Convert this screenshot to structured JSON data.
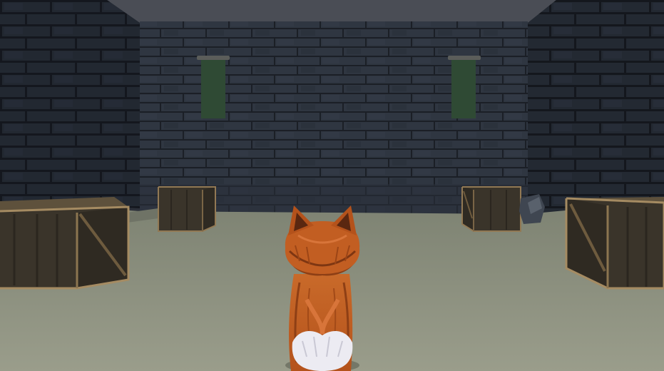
{
  "scene": {
    "setting": "dungeon-room",
    "camera": "third-person-behind-player",
    "player_character": "fox",
    "colors": {
      "ceiling": "#4a4d55",
      "wall_back": "#2f3641",
      "wall_side": "#262c35",
      "mortar": "#1b1f26",
      "floor": "#8b8f7d",
      "banner": "#29432f",
      "crate": "#3a342a",
      "crate_edge": "#a58b62",
      "fox_fur": "#c25e22",
      "fox_dark": "#7e3612",
      "fox_white": "#ecebf2"
    },
    "objects": [
      {
        "name": "crate",
        "count": 4
      },
      {
        "name": "green-banner",
        "count": 2
      },
      {
        "name": "rock",
        "count": 1
      }
    ]
  }
}
